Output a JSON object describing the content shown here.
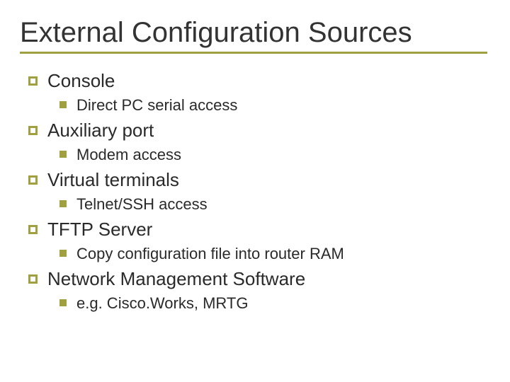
{
  "title": "External Configuration Sources",
  "items": [
    {
      "label": "Console",
      "sub": [
        {
          "label": "Direct PC serial access"
        }
      ]
    },
    {
      "label": "Auxiliary port",
      "sub": [
        {
          "label": "Modem access"
        }
      ]
    },
    {
      "label": "Virtual terminals",
      "sub": [
        {
          "label": "Telnet/SSH access"
        }
      ]
    },
    {
      "label": "TFTP Server",
      "sub": [
        {
          "label": "Copy configuration file into router RAM"
        }
      ]
    },
    {
      "label": "Network Management Software",
      "sub": [
        {
          "label": "e.g. Cisco.Works, MRTG"
        }
      ]
    }
  ]
}
